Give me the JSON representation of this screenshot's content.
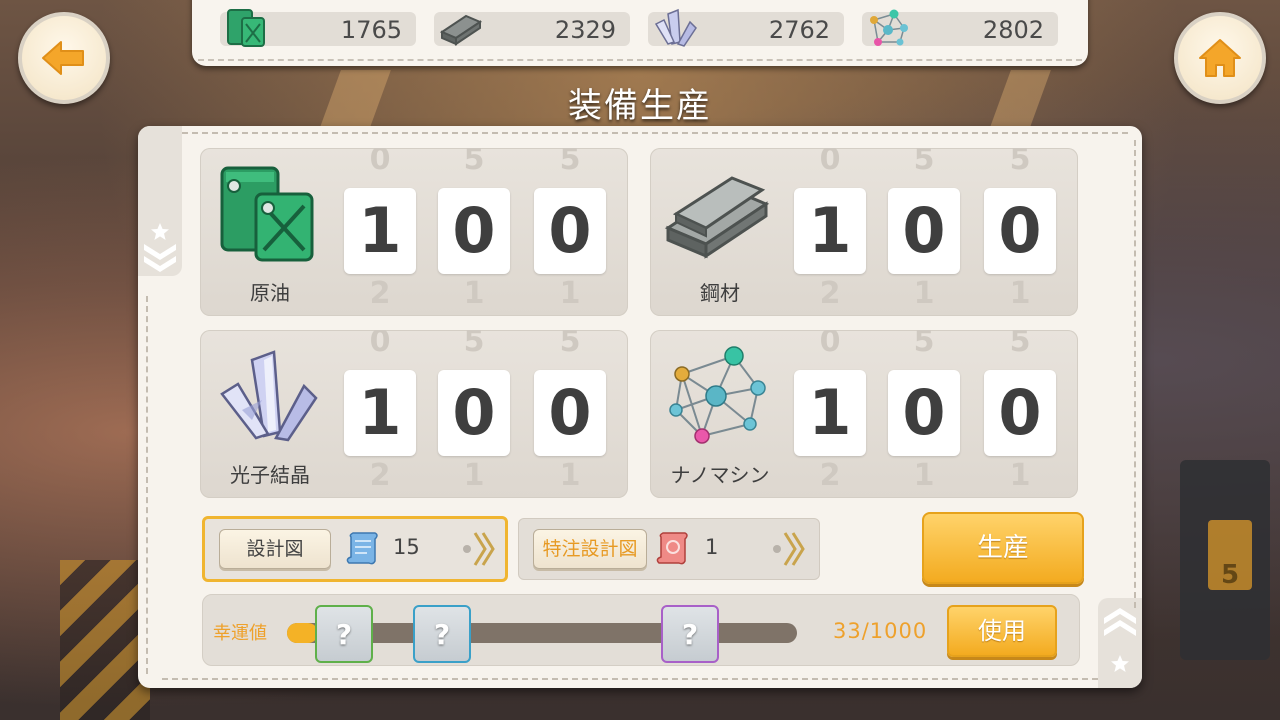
{
  "resources_bar": [
    {
      "icon": "fuel-icon",
      "value": "1765"
    },
    {
      "icon": "steel-icon",
      "value": "2329"
    },
    {
      "icon": "crystal-icon",
      "value": "2762"
    },
    {
      "icon": "nanomachine-icon",
      "value": "2802"
    }
  ],
  "title": "装備生産",
  "cards": [
    {
      "label": "原油",
      "icon": "fuel-icon",
      "digits": [
        "1",
        "0",
        "0"
      ],
      "ghost_top": [
        "0",
        "5",
        "5"
      ],
      "ghost_bottom": [
        "2",
        "1",
        "1"
      ]
    },
    {
      "label": "鋼材",
      "icon": "steel-icon",
      "digits": [
        "1",
        "0",
        "0"
      ],
      "ghost_top": [
        "0",
        "5",
        "5"
      ],
      "ghost_bottom": [
        "2",
        "1",
        "1"
      ]
    },
    {
      "label": "光子結晶",
      "icon": "crystal-icon",
      "digits": [
        "1",
        "0",
        "0"
      ],
      "ghost_top": [
        "0",
        "5",
        "5"
      ],
      "ghost_bottom": [
        "2",
        "1",
        "1"
      ]
    },
    {
      "label": "ナノマシン",
      "icon": "nanomachine-icon",
      "digits": [
        "1",
        "0",
        "0"
      ],
      "ghost_top": [
        "0",
        "5",
        "5"
      ],
      "ghost_bottom": [
        "2",
        "1",
        "1"
      ]
    }
  ],
  "blueprint": {
    "label": "設計図",
    "count": "15",
    "icon": "scroll-blue-icon"
  },
  "special_blueprint": {
    "label": "特注設計図",
    "count": "1",
    "icon": "scroll-red-icon"
  },
  "produce_label": "生産",
  "luck": {
    "label": "幸運値",
    "score": "33/1000",
    "progress": 0.033,
    "rewards": [
      {
        "symbol": "?",
        "tier_color": "#5fb04a"
      },
      {
        "symbol": "?",
        "tier_color": "#3aa0c8"
      },
      {
        "symbol": "?",
        "tier_color": "#a860c8"
      }
    ],
    "use_label": "使用"
  },
  "colors": {
    "accent": "#f3ab20",
    "luck_text": "#eea12c",
    "panel": "#f7f3ed"
  }
}
